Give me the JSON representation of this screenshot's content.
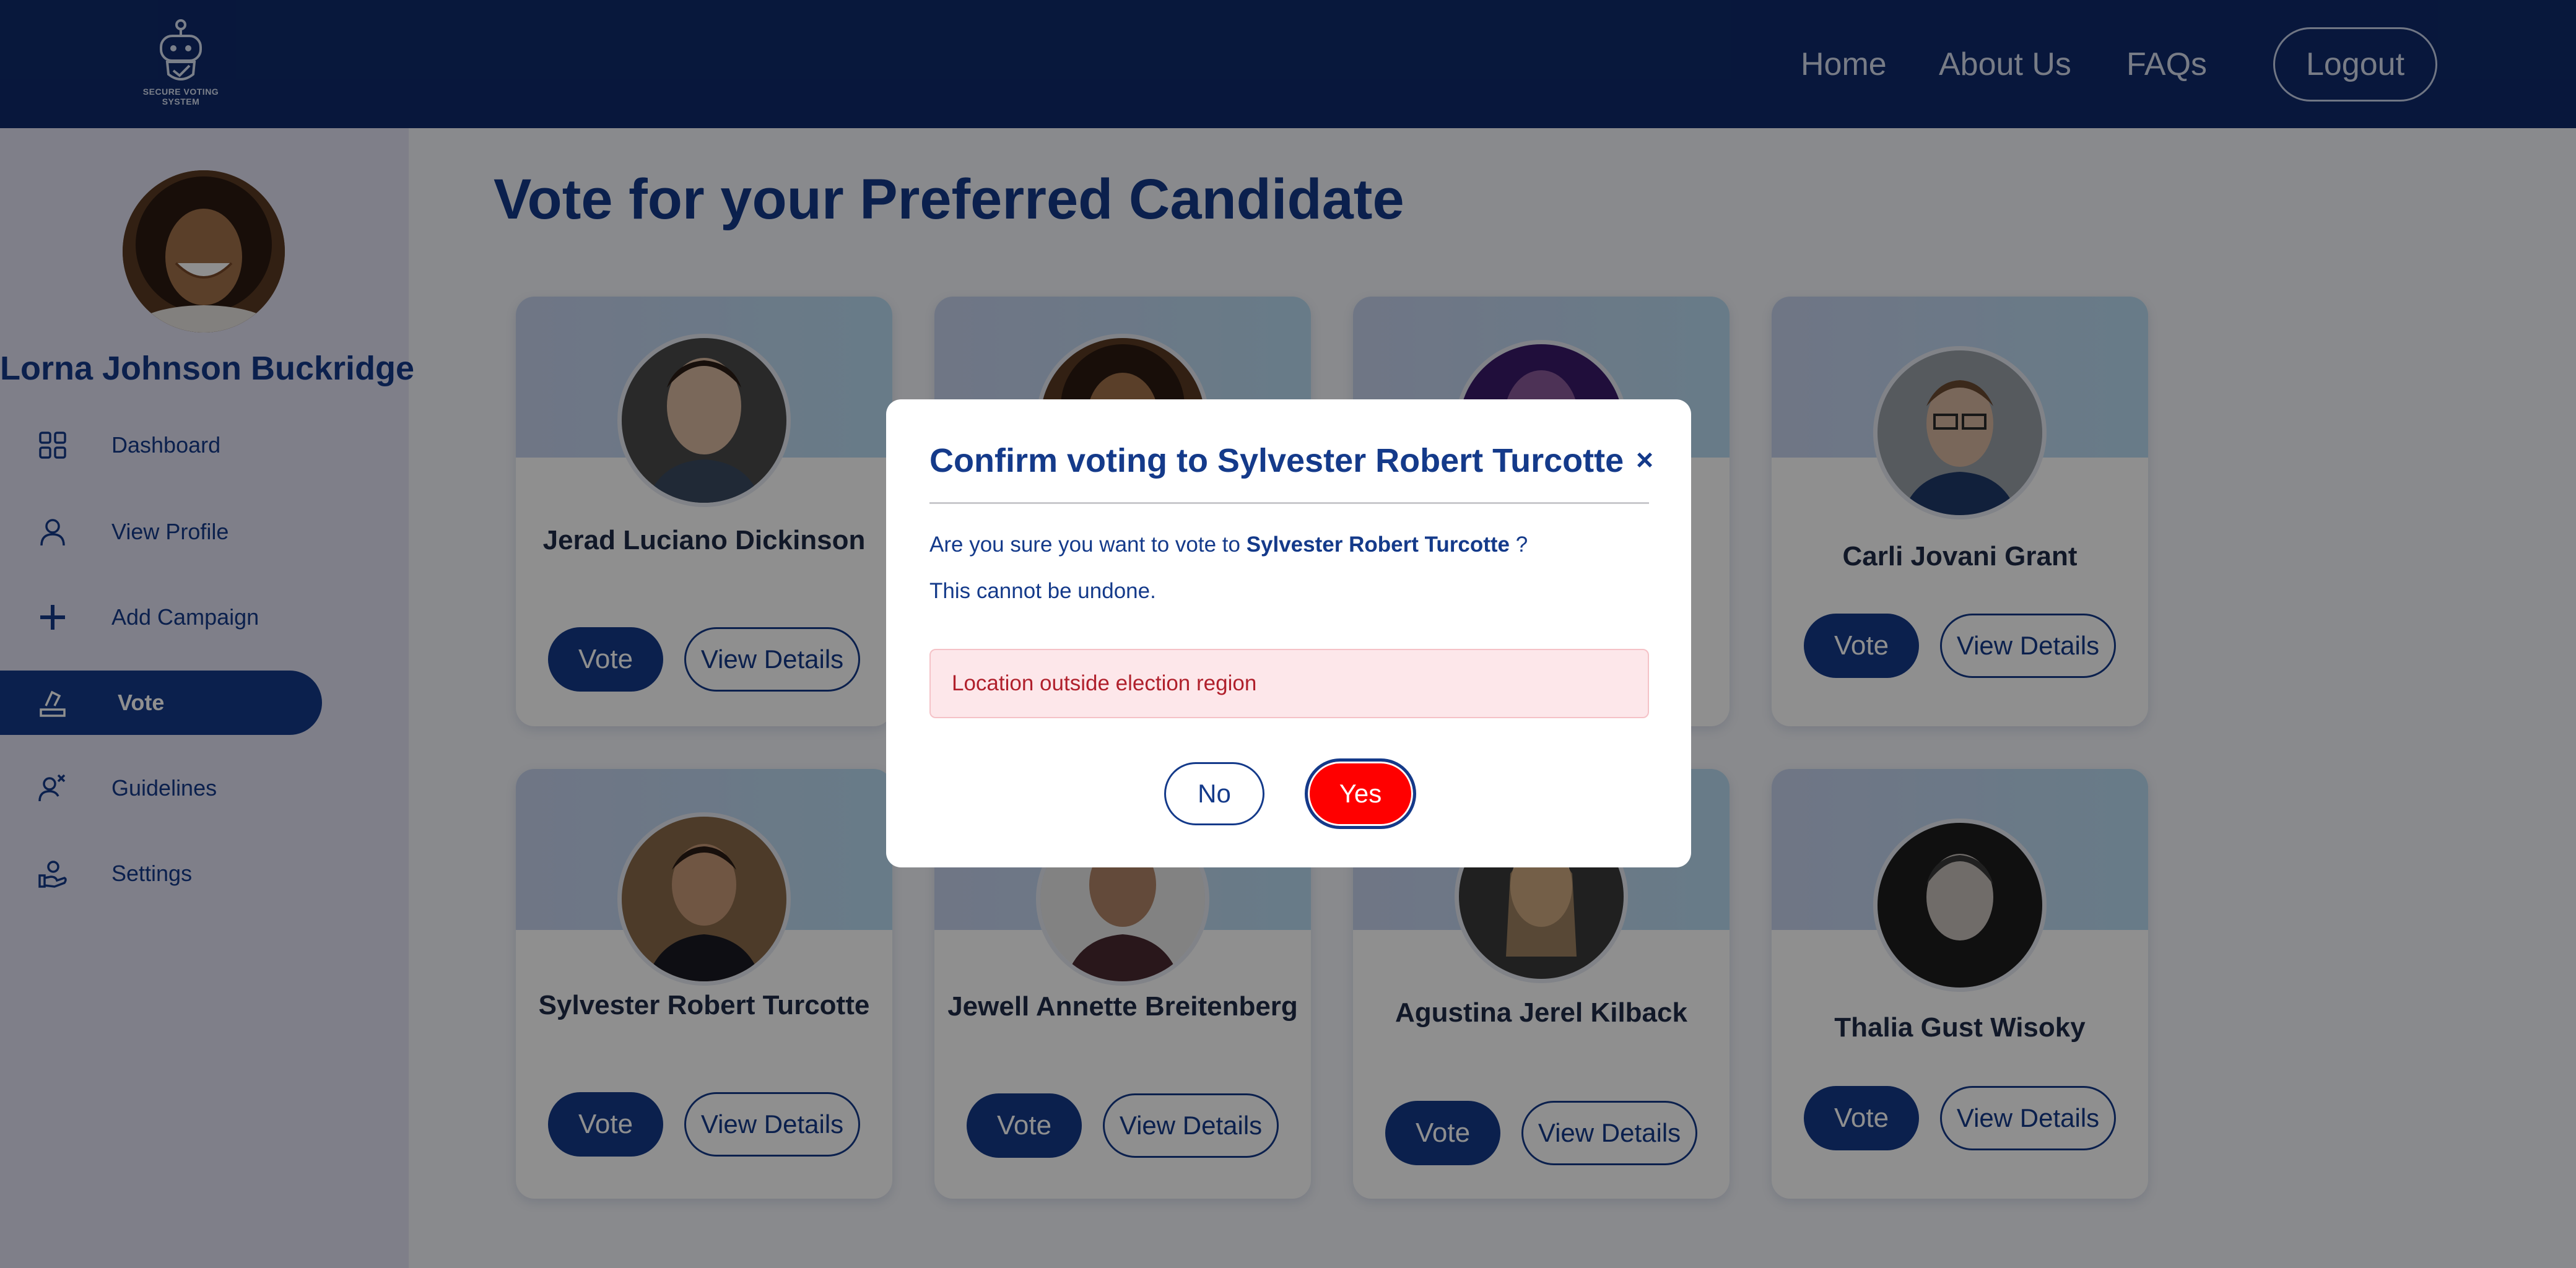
{
  "header": {
    "logo_text": "SECURE VOTING SYSTEM",
    "nav": [
      "Home",
      "About Us",
      "FAQs"
    ],
    "logout_label": "Logout"
  },
  "sidebar": {
    "user_name": "Lorna Johnson Buckridge",
    "items": [
      {
        "label": "Dashboard",
        "icon": "dashboard-icon"
      },
      {
        "label": "View Profile",
        "icon": "user-icon"
      },
      {
        "label": "Add Campaign",
        "icon": "plus-icon"
      },
      {
        "label": "Vote",
        "icon": "ballot-icon",
        "active": true
      },
      {
        "label": "Guidelines",
        "icon": "guidelines-icon"
      },
      {
        "label": "Settings",
        "icon": "settings-icon"
      }
    ]
  },
  "main": {
    "title": "Vote for your Preferred Candidate",
    "vote_label": "Vote",
    "view_details_label": "View Details",
    "candidates": [
      {
        "name": "Jerad Luciano Dickinson"
      },
      {
        "name": ""
      },
      {
        "name": ""
      },
      {
        "name": "Carli Jovani Grant"
      },
      {
        "name": "Sylvester Robert Turcotte"
      },
      {
        "name": "Jewell Annette Breitenberg"
      },
      {
        "name": "Agustina Jerel Kilback"
      },
      {
        "name": "Thalia Gust Wisoky"
      }
    ]
  },
  "modal": {
    "title": "Confirm voting to Sylvester Robert Turcotte",
    "close": "×",
    "question_prefix": "Are you sure you want to vote to",
    "candidate": "Sylvester Robert Turcotte",
    "question_suffix": "?",
    "warning": "This cannot be undone.",
    "alert": "Location outside election region",
    "no_label": "No",
    "yes_label": "Yes"
  },
  "colors": {
    "navy": "#0f2a6b",
    "accent": "#143a8a",
    "danger": "#ff0000",
    "alert_bg": "#fde7ea"
  }
}
